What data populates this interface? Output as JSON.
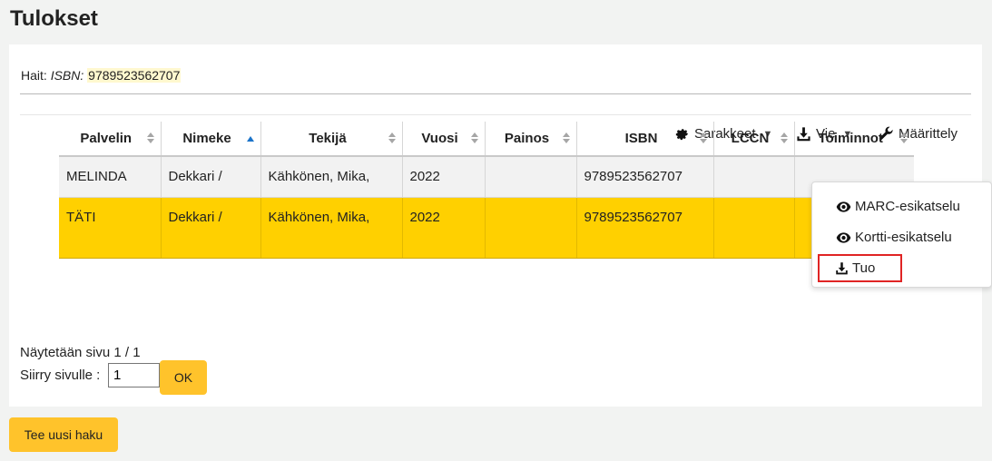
{
  "page": {
    "title": "Tulokset"
  },
  "search": {
    "prefix": "Hait:",
    "field": "ISBN:",
    "value": "9789523562707"
  },
  "toolbar": {
    "columns_label": "Sarakkeet",
    "export_label": "Vie",
    "config_label": "Määrittely"
  },
  "table": {
    "headers": [
      "Palvelin",
      "Nimeke",
      "Tekijä",
      "Vuosi",
      "Painos",
      "ISBN",
      "LCCN",
      "Toiminnot"
    ],
    "sorted_column": "Nimeke",
    "rows": [
      [
        "MELINDA",
        "Dekkari /",
        "Kähkönen, Mika,",
        "2022",
        "",
        "9789523562707",
        "",
        ""
      ],
      [
        "TÄTI",
        "Dekkari /",
        "Kähkönen, Mika,",
        "2022",
        "",
        "9789523562707",
        "",
        ""
      ]
    ],
    "highlight_color": "#ffd000"
  },
  "actions_menu": {
    "items": [
      {
        "label": "MARC-esikatselu",
        "icon": "eye-icon"
      },
      {
        "label": "Kortti-esikatselu",
        "icon": "eye-icon"
      },
      {
        "label": "Tuo",
        "icon": "download-icon"
      }
    ]
  },
  "pagination": {
    "status": "Näytetään sivu 1 / 1",
    "goto_label": "Siirry sivulle :",
    "page_value": "1",
    "ok_label": "OK"
  },
  "footer": {
    "new_search_label": "Tee uusi haku"
  },
  "colors": {
    "button": "#ffc32b",
    "highlight_row": "#ffd000",
    "sort_active": "#1a73c9",
    "focus_outline": "#e02424"
  }
}
